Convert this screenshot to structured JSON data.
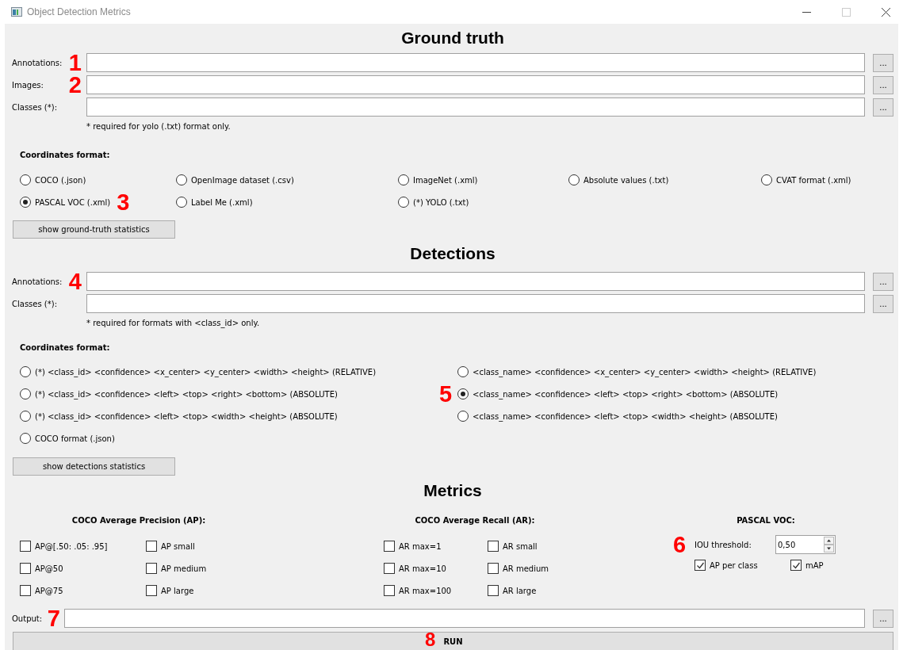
{
  "window": {
    "title": "Object Detection Metrics"
  },
  "ground_truth": {
    "heading": "Ground truth",
    "fields": [
      {
        "label": "Annotations:",
        "marker": "1",
        "button": "..."
      },
      {
        "label": "Images:",
        "marker": "2",
        "button": "..."
      },
      {
        "label": "Classes (*):",
        "button": "..."
      }
    ],
    "note": "* required for yolo (.txt) format only.",
    "format_heading": "Coordinates format:",
    "formats": [
      {
        "label": "COCO (.json)",
        "selected": false
      },
      {
        "label": "OpenImage dataset (.csv)",
        "selected": false
      },
      {
        "label": "ImageNet (.xml)",
        "selected": false
      },
      {
        "label": "Absolute values (.txt)",
        "selected": false
      },
      {
        "label": "CVAT format (.xml)",
        "selected": false
      },
      {
        "label": "PASCAL VOC (.xml)",
        "selected": true,
        "marker": "3"
      },
      {
        "label": "Label Me (.xml)",
        "selected": false
      },
      {
        "label": "(*) YOLO (.txt)",
        "selected": false
      }
    ],
    "stats_button": "show ground-truth statistics"
  },
  "detections": {
    "heading": "Detections",
    "fields": [
      {
        "label": "Annotations:",
        "marker": "4",
        "button": "..."
      },
      {
        "label": "Classes (*):",
        "button": "..."
      }
    ],
    "note": "* required for formats with <class_id> only.",
    "format_heading": "Coordinates format:",
    "formats": [
      {
        "label": "(*) <class_id> <confidence> <x_center> <y_center> <width> <height> (RELATIVE)",
        "selected": false
      },
      {
        "label": "<class_name> <confidence> <x_center> <y_center> <width> <height> (RELATIVE)",
        "selected": false
      },
      {
        "label": "(*) <class_id> <confidence> <left> <top> <right> <bottom> (ABSOLUTE)",
        "selected": false
      },
      {
        "label": "<class_name> <confidence> <left> <top> <right> <bottom> (ABSOLUTE)",
        "selected": true,
        "marker": "5"
      },
      {
        "label": "(*) <class_id> <confidence> <left> <top> <width> <height> (ABSOLUTE)",
        "selected": false
      },
      {
        "label": "<class_name> <confidence> <left> <top> <width> <height> (ABSOLUTE)",
        "selected": false
      },
      {
        "label": "COCO format (.json)",
        "selected": false
      }
    ],
    "stats_button": "show detections statistics"
  },
  "metrics": {
    "heading": "Metrics",
    "coco_ap": {
      "heading": "COCO Average Precision (AP):",
      "options": [
        {
          "label": "AP@[.50: .05: .95]",
          "checked": false
        },
        {
          "label": "AP small",
          "checked": false
        },
        {
          "label": "AP@50",
          "checked": false
        },
        {
          "label": "AP medium",
          "checked": false
        },
        {
          "label": "AP@75",
          "checked": false
        },
        {
          "label": "AP large",
          "checked": false
        }
      ]
    },
    "coco_ar": {
      "heading": "COCO Average Recall (AR):",
      "options": [
        {
          "label": "AR max=1",
          "checked": false
        },
        {
          "label": "AR small",
          "checked": false
        },
        {
          "label": "AR max=10",
          "checked": false
        },
        {
          "label": "AR medium",
          "checked": false
        },
        {
          "label": "AR max=100",
          "checked": false
        },
        {
          "label": "AR large",
          "checked": false
        }
      ]
    },
    "pascal": {
      "heading": "PASCAL VOC:",
      "marker": "6",
      "iou_label": "IOU threshold:",
      "iou_value": "0,50",
      "options": [
        {
          "label": "AP per class",
          "checked": true
        },
        {
          "label": "mAP",
          "checked": true
        }
      ]
    }
  },
  "output": {
    "label": "Output:",
    "marker": "7",
    "button": "..."
  },
  "run": {
    "label": "RUN",
    "marker": "8"
  }
}
